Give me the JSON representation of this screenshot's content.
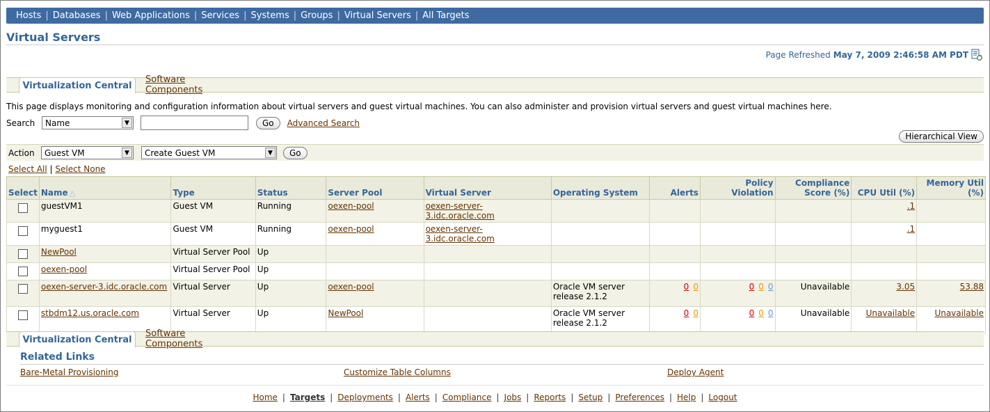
{
  "topnav": {
    "items": [
      "Hosts",
      "Databases",
      "Web Applications",
      "Services",
      "Systems",
      "Groups",
      "Virtual Servers",
      "All Targets"
    ]
  },
  "page": {
    "title": "Virtual Servers",
    "refreshed_label": "Page Refreshed",
    "refreshed_time": "May 7, 2009 2:46:58 AM PDT"
  },
  "tabs": {
    "active": "Virtualization Central",
    "other": "Software Components"
  },
  "description": "This page displays monitoring and configuration information about virtual servers and guest virtual machines. You can also administer and provision virtual servers and guest virtual machines here.",
  "search": {
    "label": "Search",
    "field": "Name",
    "value": "",
    "go": "Go",
    "advanced": "Advanced Search"
  },
  "hierarchical_view": "Hierarchical View",
  "action": {
    "label": "Action",
    "type": "Guest VM",
    "operation": "Create Guest VM",
    "go": "Go"
  },
  "selection": {
    "select_all": "Select All",
    "select_none": "Select None",
    "sep": "|"
  },
  "table": {
    "headers": {
      "select": "Select",
      "name": "Name",
      "sort_icon": "△",
      "type": "Type",
      "status": "Status",
      "server_pool": "Server Pool",
      "virtual_server": "Virtual Server",
      "os": "Operating System",
      "alerts": "Alerts",
      "policy": "Policy Violation",
      "compliance": "Compliance Score (%)",
      "cpu": "CPU Util (%)",
      "memory": "Memory Util (%)"
    },
    "rows": [
      {
        "name": "guestVM1",
        "name_link": false,
        "type": "Guest VM",
        "status": "Running",
        "pool": "oexen-pool",
        "server": "oexen-server-3.idc.oracle.com",
        "os1": "",
        "os2": "",
        "alerts": [
          "",
          ""
        ],
        "policy": [
          "",
          "",
          ""
        ],
        "compliance": "",
        "cpu": ".1",
        "memory": ""
      },
      {
        "name": "myguest1",
        "name_link": false,
        "type": "Guest VM",
        "status": "Running",
        "pool": "oexen-pool",
        "server": "oexen-server-3.idc.oracle.com",
        "os1": "",
        "os2": "",
        "alerts": [
          "",
          ""
        ],
        "policy": [
          "",
          "",
          ""
        ],
        "compliance": "",
        "cpu": ".1",
        "memory": ""
      },
      {
        "name": "NewPool",
        "name_link": true,
        "type": "Virtual Server Pool",
        "status": "Up",
        "pool": "",
        "server": "",
        "os1": "",
        "os2": "",
        "alerts": [
          "",
          ""
        ],
        "policy": [
          "",
          "",
          ""
        ],
        "compliance": "",
        "cpu": "",
        "memory": ""
      },
      {
        "name": "oexen-pool",
        "name_link": true,
        "type": "Virtual Server Pool",
        "status": "Up",
        "pool": "",
        "server": "",
        "os1": "",
        "os2": "",
        "alerts": [
          "",
          ""
        ],
        "policy": [
          "",
          "",
          ""
        ],
        "compliance": "",
        "cpu": "",
        "memory": ""
      },
      {
        "name": "oexen-server-3.idc.oracle.com",
        "name_link": true,
        "type": "Virtual Server",
        "status": "Up",
        "pool": "oexen-pool",
        "server": "",
        "os1": "Oracle VM server",
        "os2": "release 2.1.2",
        "alerts": [
          "0",
          "0"
        ],
        "policy": [
          "0",
          "0",
          "0"
        ],
        "compliance": "Unavailable",
        "cpu": "3.05",
        "memory": "53.88"
      },
      {
        "name": "stbdm12.us.oracle.com",
        "name_link": true,
        "type": "Virtual Server",
        "status": "Up",
        "pool": "NewPool",
        "server": "",
        "os1": "Oracle VM server",
        "os2": "release 2.1.2",
        "alerts": [
          "0",
          "0"
        ],
        "policy": [
          "0",
          "0",
          "0"
        ],
        "compliance": "Unavailable",
        "cpu": "Unavailable",
        "memory": "Unavailable"
      }
    ]
  },
  "related": {
    "title": "Related Links",
    "links": [
      "Bare-Metal Provisioning",
      "Customize Table Columns",
      "Deploy Agent"
    ]
  },
  "footer": {
    "links": [
      "Home",
      "Targets",
      "Deployments",
      "Alerts",
      "Compliance",
      "Jobs",
      "Reports",
      "Setup",
      "Preferences",
      "Help",
      "Logout"
    ],
    "active": "Targets",
    "sep": "|"
  },
  "colors": {
    "nav_bg": "#3e6aa1",
    "header_text": "#336699",
    "link": "#663300",
    "band": "#f2f2e6",
    "alert_red": "#cc0000",
    "alert_orange": "#e89b00",
    "info_blue": "#6699cc"
  }
}
